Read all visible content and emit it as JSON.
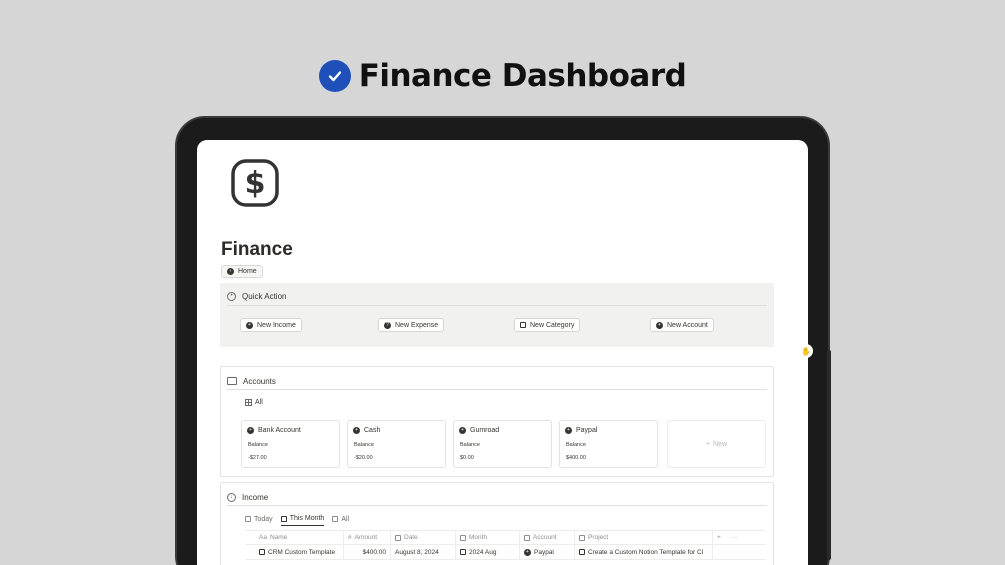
{
  "hero": {
    "title": "Finance Dashboard",
    "icon": "check-circle-icon",
    "icon_color": "#1f4fb8"
  },
  "page": {
    "icon": "dollar-icon",
    "title": "Finance",
    "breadcrumb": "Home"
  },
  "quick_action": {
    "title": "Quick Action",
    "buttons": [
      {
        "label": "New Income",
        "icon": "income-icon"
      },
      {
        "label": "New Expense",
        "icon": "expense-icon"
      },
      {
        "label": "New Category",
        "icon": "category-icon"
      },
      {
        "label": "New Account",
        "icon": "account-icon"
      }
    ]
  },
  "accounts": {
    "title": "Accounts",
    "view": "All",
    "items": [
      {
        "name": "Bank Account",
        "balance_label": "Balance",
        "balance": "-$27.00"
      },
      {
        "name": "Cash",
        "balance_label": "Balance",
        "balance": "-$20.00"
      },
      {
        "name": "Gumroad",
        "balance_label": "Balance",
        "balance": "$0.00"
      },
      {
        "name": "Paypal",
        "balance_label": "Balance",
        "balance": "$400.00"
      }
    ],
    "new_label": "New"
  },
  "income": {
    "title": "Income",
    "tabs": [
      "Today",
      "This Month",
      "All"
    ],
    "active_tab": "This Month",
    "columns": [
      "Name",
      "Amount",
      "Date",
      "Month",
      "Account",
      "Project"
    ],
    "name_prefix": "Aa",
    "rows": [
      {
        "name": "CRM Custom Template",
        "amount": "$400.00",
        "date": "August 8, 2024",
        "month": "2024 Aug",
        "account": "Paypal",
        "project": "Create a Custom Notion Template for Cl"
      }
    ]
  }
}
